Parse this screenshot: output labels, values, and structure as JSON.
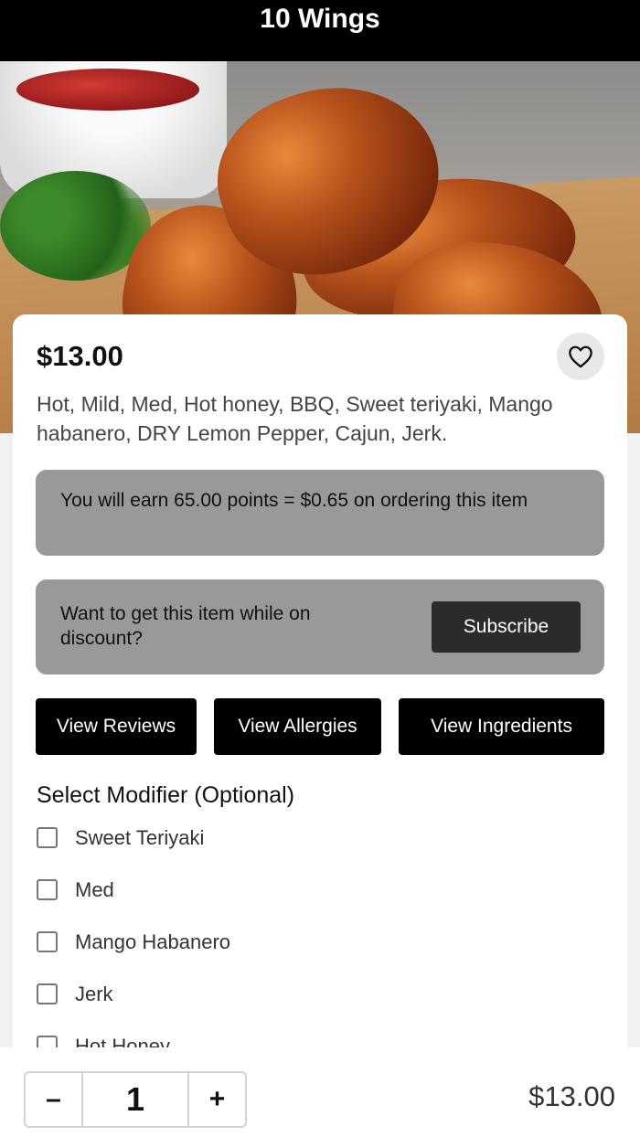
{
  "header": {
    "title": "10 Wings"
  },
  "item": {
    "price": "$13.00",
    "description": "Hot, Mild, Med, Hot honey, BBQ, Sweet teriyaki, Mango habanero, DRY Lemon Pepper, Cajun, Jerk.",
    "favorite_icon": "heart-outline-icon"
  },
  "points_banner": {
    "text": "You will earn 65.00 points = $0.65 on ordering this item"
  },
  "promo": {
    "text": "Want to get this item while on discount?",
    "button_label": "Subscribe"
  },
  "actions": {
    "reviews": "View Reviews",
    "allergies": "View Allergies",
    "ingredients": "View Ingredients"
  },
  "modifiers": {
    "title": "Select Modifier (Optional)",
    "items": [
      {
        "label": "Sweet Teriyaki",
        "checked": false
      },
      {
        "label": "Med",
        "checked": false
      },
      {
        "label": "Mango Habanero",
        "checked": false
      },
      {
        "label": "Jerk",
        "checked": false
      },
      {
        "label": "Hot Honey",
        "checked": false
      }
    ]
  },
  "cart": {
    "minus_label": "–",
    "quantity": "1",
    "plus_label": "+",
    "total": "$13.00"
  }
}
